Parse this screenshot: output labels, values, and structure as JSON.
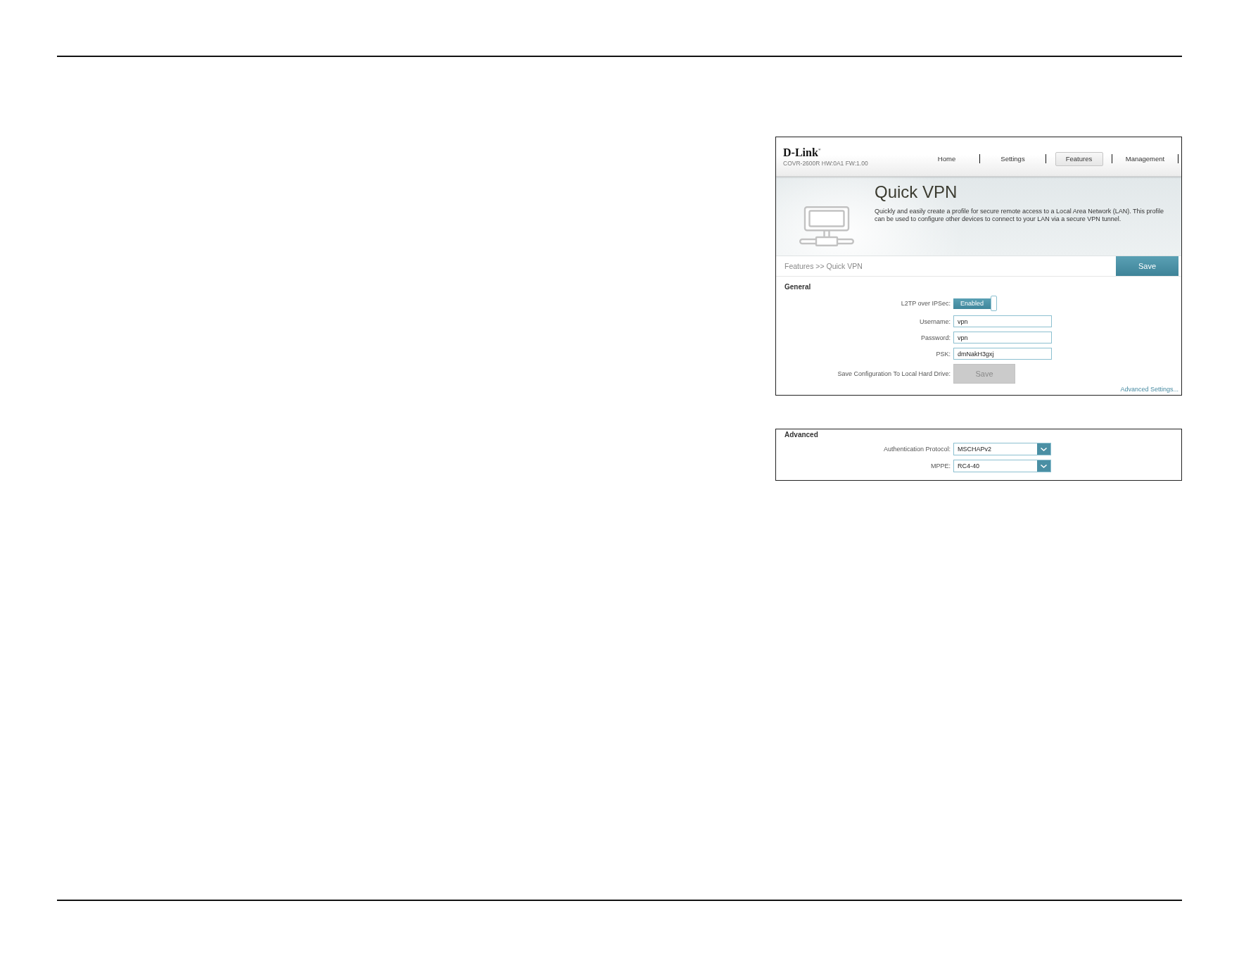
{
  "router_page": {
    "brand": {
      "logo": "D-Link$^{®}$",
      "model": "COVR-2600R HW:0A1 FW:1.00"
    },
    "nav_tabs": [
      {
        "label": "Home",
        "selected": false
      },
      {
        "label": "Settings",
        "selected": false
      },
      {
        "label": "Features",
        "selected": true
      },
      {
        "label": "Management",
        "selected": false
      }
    ],
    "hero": {
      "title": "Quick VPN",
      "description": "Quickly and easily create a profile for secure remote access to a Local Area Network (LAN). This profile can be used to configure other devices to connect to your LAN via a secure VPN tunnel."
    },
    "breadcrumb": "Features >> Quick VPN",
    "save_button": "Save",
    "general": {
      "heading": "General",
      "fields": [
        {
          "kind": "toggle",
          "label": "L2TP over IPSec:",
          "value": "Enabled",
          "on": true
        },
        {
          "kind": "text",
          "label": "Username:",
          "value": "vpn"
        },
        {
          "kind": "text",
          "label": "Password:",
          "value": "vpn"
        },
        {
          "kind": "text",
          "label": "PSK:",
          "value": "dmNakH3gxj"
        },
        {
          "kind": "button",
          "label": "Save Configuration To Local Hard Drive:",
          "value": "Save",
          "disabled": true
        }
      ]
    },
    "advanced_link": "Advanced Settings..."
  },
  "advanced_panel": {
    "heading": "Advanced",
    "fields": [
      {
        "kind": "select",
        "label": "Authentication Protocol:",
        "value": "MSCHAPv2"
      },
      {
        "kind": "select",
        "label": "MPPE:",
        "value": "RC4-40"
      }
    ]
  }
}
